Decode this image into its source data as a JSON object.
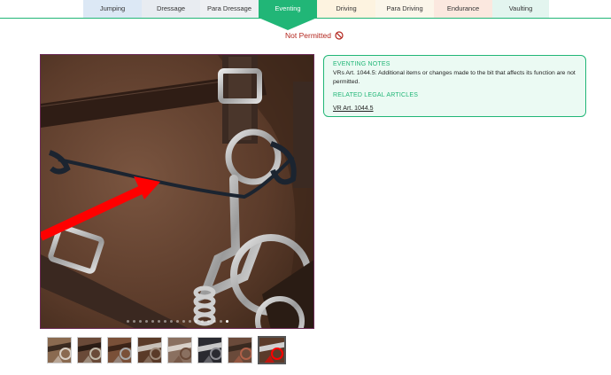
{
  "tabs": [
    {
      "label": "Jumping"
    },
    {
      "label": "Dressage"
    },
    {
      "label": "Para Dressage"
    },
    {
      "label": "Eventing"
    },
    {
      "label": "Driving"
    },
    {
      "label": "Para Driving"
    },
    {
      "label": "Endurance"
    },
    {
      "label": "Vaulting"
    }
  ],
  "active_tab": "Eventing",
  "status": {
    "text": "Not Permitted",
    "icon": "not-allowed-icon",
    "color": "#b3261e"
  },
  "notes": {
    "heading": "EVENTING NOTES",
    "text": "VRs Art. 1044.5: Additional items or changes made to the bit that affects its function are not permitted.",
    "related_heading": "RELATED LEGAL ARTICLES",
    "related_link": "VR Art. 1044.5"
  },
  "gallery": {
    "dot_count": 17,
    "active_dot": 16,
    "thumbnail_count": 8,
    "selected_thumbnail": 8
  },
  "colors": {
    "accent": "#21b677",
    "warning": "#b3261e",
    "arrow": "#ff0000"
  }
}
